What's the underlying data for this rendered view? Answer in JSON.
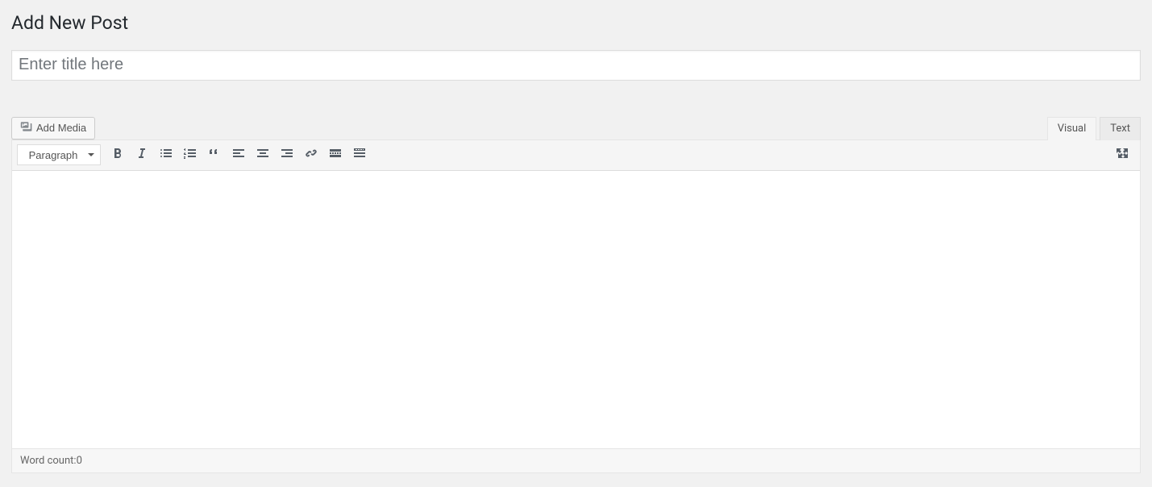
{
  "page": {
    "title": "Add New Post"
  },
  "title_field": {
    "value": "",
    "placeholder": "Enter title here"
  },
  "media_button": {
    "label": "Add Media"
  },
  "tabs": {
    "visual": "Visual",
    "text": "Text",
    "active": "visual"
  },
  "toolbar": {
    "format_select": {
      "label": "Paragraph"
    },
    "buttons": [
      "bold",
      "italic",
      "bullet-list",
      "number-list",
      "blockquote",
      "align-left",
      "align-center",
      "align-right",
      "link",
      "read-more",
      "toolbar-toggle"
    ],
    "fullscreen": "fullscreen"
  },
  "status": {
    "word_count_label": "Word count: ",
    "word_count_value": "0"
  }
}
